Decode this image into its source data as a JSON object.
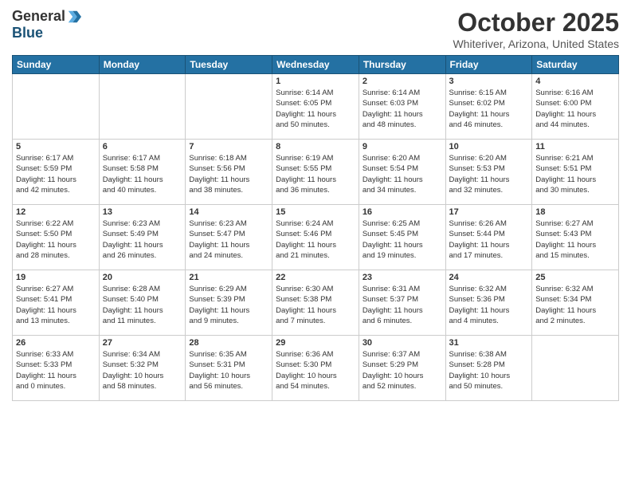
{
  "logo": {
    "general": "General",
    "blue": "Blue"
  },
  "header": {
    "month": "October 2025",
    "location": "Whiteriver, Arizona, United States"
  },
  "weekdays": [
    "Sunday",
    "Monday",
    "Tuesday",
    "Wednesday",
    "Thursday",
    "Friday",
    "Saturday"
  ],
  "weeks": [
    [
      {
        "day": "",
        "info": ""
      },
      {
        "day": "",
        "info": ""
      },
      {
        "day": "",
        "info": ""
      },
      {
        "day": "1",
        "info": "Sunrise: 6:14 AM\nSunset: 6:05 PM\nDaylight: 11 hours\nand 50 minutes."
      },
      {
        "day": "2",
        "info": "Sunrise: 6:14 AM\nSunset: 6:03 PM\nDaylight: 11 hours\nand 48 minutes."
      },
      {
        "day": "3",
        "info": "Sunrise: 6:15 AM\nSunset: 6:02 PM\nDaylight: 11 hours\nand 46 minutes."
      },
      {
        "day": "4",
        "info": "Sunrise: 6:16 AM\nSunset: 6:00 PM\nDaylight: 11 hours\nand 44 minutes."
      }
    ],
    [
      {
        "day": "5",
        "info": "Sunrise: 6:17 AM\nSunset: 5:59 PM\nDaylight: 11 hours\nand 42 minutes."
      },
      {
        "day": "6",
        "info": "Sunrise: 6:17 AM\nSunset: 5:58 PM\nDaylight: 11 hours\nand 40 minutes."
      },
      {
        "day": "7",
        "info": "Sunrise: 6:18 AM\nSunset: 5:56 PM\nDaylight: 11 hours\nand 38 minutes."
      },
      {
        "day": "8",
        "info": "Sunrise: 6:19 AM\nSunset: 5:55 PM\nDaylight: 11 hours\nand 36 minutes."
      },
      {
        "day": "9",
        "info": "Sunrise: 6:20 AM\nSunset: 5:54 PM\nDaylight: 11 hours\nand 34 minutes."
      },
      {
        "day": "10",
        "info": "Sunrise: 6:20 AM\nSunset: 5:53 PM\nDaylight: 11 hours\nand 32 minutes."
      },
      {
        "day": "11",
        "info": "Sunrise: 6:21 AM\nSunset: 5:51 PM\nDaylight: 11 hours\nand 30 minutes."
      }
    ],
    [
      {
        "day": "12",
        "info": "Sunrise: 6:22 AM\nSunset: 5:50 PM\nDaylight: 11 hours\nand 28 minutes."
      },
      {
        "day": "13",
        "info": "Sunrise: 6:23 AM\nSunset: 5:49 PM\nDaylight: 11 hours\nand 26 minutes."
      },
      {
        "day": "14",
        "info": "Sunrise: 6:23 AM\nSunset: 5:47 PM\nDaylight: 11 hours\nand 24 minutes."
      },
      {
        "day": "15",
        "info": "Sunrise: 6:24 AM\nSunset: 5:46 PM\nDaylight: 11 hours\nand 21 minutes."
      },
      {
        "day": "16",
        "info": "Sunrise: 6:25 AM\nSunset: 5:45 PM\nDaylight: 11 hours\nand 19 minutes."
      },
      {
        "day": "17",
        "info": "Sunrise: 6:26 AM\nSunset: 5:44 PM\nDaylight: 11 hours\nand 17 minutes."
      },
      {
        "day": "18",
        "info": "Sunrise: 6:27 AM\nSunset: 5:43 PM\nDaylight: 11 hours\nand 15 minutes."
      }
    ],
    [
      {
        "day": "19",
        "info": "Sunrise: 6:27 AM\nSunset: 5:41 PM\nDaylight: 11 hours\nand 13 minutes."
      },
      {
        "day": "20",
        "info": "Sunrise: 6:28 AM\nSunset: 5:40 PM\nDaylight: 11 hours\nand 11 minutes."
      },
      {
        "day": "21",
        "info": "Sunrise: 6:29 AM\nSunset: 5:39 PM\nDaylight: 11 hours\nand 9 minutes."
      },
      {
        "day": "22",
        "info": "Sunrise: 6:30 AM\nSunset: 5:38 PM\nDaylight: 11 hours\nand 7 minutes."
      },
      {
        "day": "23",
        "info": "Sunrise: 6:31 AM\nSunset: 5:37 PM\nDaylight: 11 hours\nand 6 minutes."
      },
      {
        "day": "24",
        "info": "Sunrise: 6:32 AM\nSunset: 5:36 PM\nDaylight: 11 hours\nand 4 minutes."
      },
      {
        "day": "25",
        "info": "Sunrise: 6:32 AM\nSunset: 5:34 PM\nDaylight: 11 hours\nand 2 minutes."
      }
    ],
    [
      {
        "day": "26",
        "info": "Sunrise: 6:33 AM\nSunset: 5:33 PM\nDaylight: 11 hours\nand 0 minutes."
      },
      {
        "day": "27",
        "info": "Sunrise: 6:34 AM\nSunset: 5:32 PM\nDaylight: 10 hours\nand 58 minutes."
      },
      {
        "day": "28",
        "info": "Sunrise: 6:35 AM\nSunset: 5:31 PM\nDaylight: 10 hours\nand 56 minutes."
      },
      {
        "day": "29",
        "info": "Sunrise: 6:36 AM\nSunset: 5:30 PM\nDaylight: 10 hours\nand 54 minutes."
      },
      {
        "day": "30",
        "info": "Sunrise: 6:37 AM\nSunset: 5:29 PM\nDaylight: 10 hours\nand 52 minutes."
      },
      {
        "day": "31",
        "info": "Sunrise: 6:38 AM\nSunset: 5:28 PM\nDaylight: 10 hours\nand 50 minutes."
      },
      {
        "day": "",
        "info": ""
      }
    ]
  ]
}
